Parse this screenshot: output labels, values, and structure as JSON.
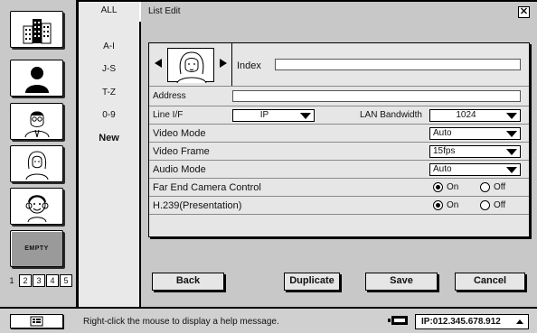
{
  "sidebar": {
    "empty_label": "EMPTY",
    "pages": [
      "1",
      "2",
      "3",
      "4",
      "5"
    ],
    "active_page": "1"
  },
  "alpha_index": [
    "ALL",
    "A-I",
    "J-S",
    "T-Z",
    "0-9",
    "New"
  ],
  "dialog": {
    "title": "List Edit",
    "close_symbol": "✕",
    "index_label": "Index",
    "index_value": "",
    "address_label": "Address",
    "address_value": "",
    "line_if_label": "Line I/F",
    "line_if_value": "IP",
    "lan_bandwidth_label": "LAN Bandwidth",
    "lan_bandwidth_value": "1024",
    "video_mode_label": "Video Mode",
    "video_mode_value": "Auto",
    "video_frame_label": "Video Frame",
    "video_frame_value": "15fps",
    "audio_mode_label": "Audio Mode",
    "audio_mode_value": "Auto",
    "fecc_label": "Far End Camera Control",
    "fecc_on": "On",
    "fecc_off": "Off",
    "fecc_selected": "On",
    "h239_label": "H.239(Presentation)",
    "h239_on": "On",
    "h239_off": "Off",
    "h239_selected": "On"
  },
  "buttons": {
    "back": "Back",
    "duplicate": "Duplicate",
    "save": "Save",
    "cancel": "Cancel"
  },
  "status": {
    "message": "Right-click the mouse to display a help message.",
    "ip": "IP:012.345.678.912"
  }
}
